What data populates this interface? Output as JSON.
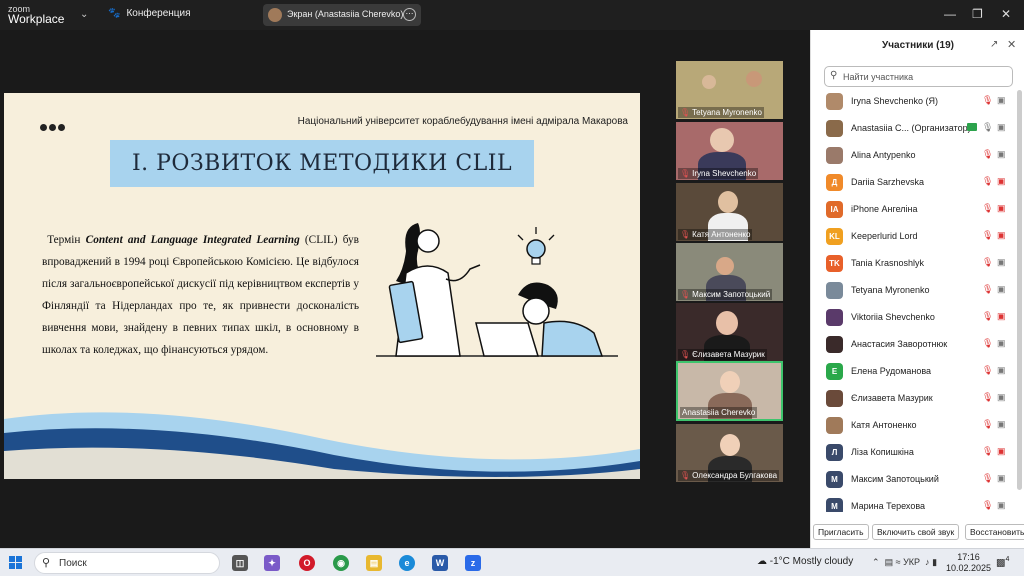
{
  "titlebar": {
    "logo_top": "zoom",
    "logo_bottom": "Workplace",
    "meeting_menu": "Конференция",
    "share_label": "Экран (Anastasiia Cherevko)"
  },
  "slide": {
    "university": "Національний університет кораблебудування імені адмірала Макарова",
    "title": "I. РОЗВИТОК МЕТОДИКИ CLIL",
    "para_lead": "Термін",
    "para_term": "Content and Language Integrated Learning",
    "para_rest": "(CLIL) був впроваджений в 1994 році Європейською Комісією. Це відбулося після загальноєвропейської дискусії під керівництвом експертів у Фінляндії та Нідерландах про те, як привнести досконалість вивчення мови, знайдену в певних типах шкіл, в основному в школах та коледжах, що фінансуються урядом."
  },
  "tiles": [
    {
      "name": "Tetyana Myronenko",
      "muted": true,
      "active": false
    },
    {
      "name": "Iryna Shevchenko",
      "muted": true,
      "active": false
    },
    {
      "name": "Катя Антоненко",
      "muted": true,
      "active": false
    },
    {
      "name": "Максим Запотоцький",
      "muted": true,
      "active": false
    },
    {
      "name": "Єлизавета Мазурик",
      "muted": true,
      "active": false
    },
    {
      "name": "Anastasiia Cherevko",
      "muted": false,
      "active": true
    },
    {
      "name": "Олександра Булгакова",
      "muted": true,
      "active": false
    }
  ],
  "panel": {
    "title": "Участники (19)",
    "search_placeholder": "Найти участника",
    "participants": [
      {
        "name": "Iryna Shevchenko (Я)",
        "initials": "",
        "color": "#b08a6a",
        "mic_on": false,
        "cam_off": false
      },
      {
        "name": "Anastasiia C...  (Организатор)",
        "initials": "",
        "color": "#8a6a4a",
        "mic_on": true,
        "cam_off": false,
        "sharing": true
      },
      {
        "name": "Alina Antypenko",
        "initials": "",
        "color": "#9a7a6a",
        "mic_on": false,
        "cam_off": false
      },
      {
        "name": "Dariia Sarzhevska",
        "initials": "Д",
        "color": "#f08a2a",
        "mic_on": false,
        "cam_off": true
      },
      {
        "name": "iPhone Ангеліна",
        "initials": "IA",
        "color": "#e06a2a",
        "mic_on": false,
        "cam_off": true
      },
      {
        "name": "Keeperlurid Lord",
        "initials": "KL",
        "color": "#f0a020",
        "mic_on": false,
        "cam_off": true
      },
      {
        "name": "Tania Krasnoshlyk",
        "initials": "TK",
        "color": "#e8602a",
        "mic_on": false,
        "cam_off": false
      },
      {
        "name": "Tetyana Myronenko",
        "initials": "",
        "color": "#7a8a9a",
        "mic_on": false,
        "cam_off": false
      },
      {
        "name": "Viktoriia Shevchenko",
        "initials": "",
        "color": "#5a3a6a",
        "mic_on": false,
        "cam_off": true
      },
      {
        "name": "Анастасия Заворотнюк",
        "initials": "",
        "color": "#3a2a2a",
        "mic_on": false,
        "cam_off": false
      },
      {
        "name": "Елена Рудоманова",
        "initials": "Е",
        "color": "#2aa84a",
        "mic_on": false,
        "cam_off": false
      },
      {
        "name": "Єлизавета Мазурик",
        "initials": "",
        "color": "#6a4a3a",
        "mic_on": false,
        "cam_off": false
      },
      {
        "name": "Катя Антоненко",
        "initials": "",
        "color": "#a07a5a",
        "mic_on": false,
        "cam_off": false
      },
      {
        "name": "Ліза Копишкіна",
        "initials": "Л",
        "color": "#3a4a6a",
        "mic_on": false,
        "cam_off": true
      },
      {
        "name": "Максим Запотоцький",
        "initials": "М",
        "color": "#3a4a6a",
        "mic_on": false,
        "cam_off": false
      },
      {
        "name": "Марина Терехова",
        "initials": "М",
        "color": "#3a4a6a",
        "mic_on": false,
        "cam_off": false
      }
    ],
    "btn_invite": "Пригласить",
    "btn_unmute": "Включить свой звук",
    "btn_restore": "Восстановить"
  },
  "taskbar": {
    "search": "Поиск",
    "weather": "-1°C  Mostly cloudy",
    "lang": "УКР",
    "time": "17:16",
    "date": "10.02.2025",
    "notif_count": "4"
  }
}
